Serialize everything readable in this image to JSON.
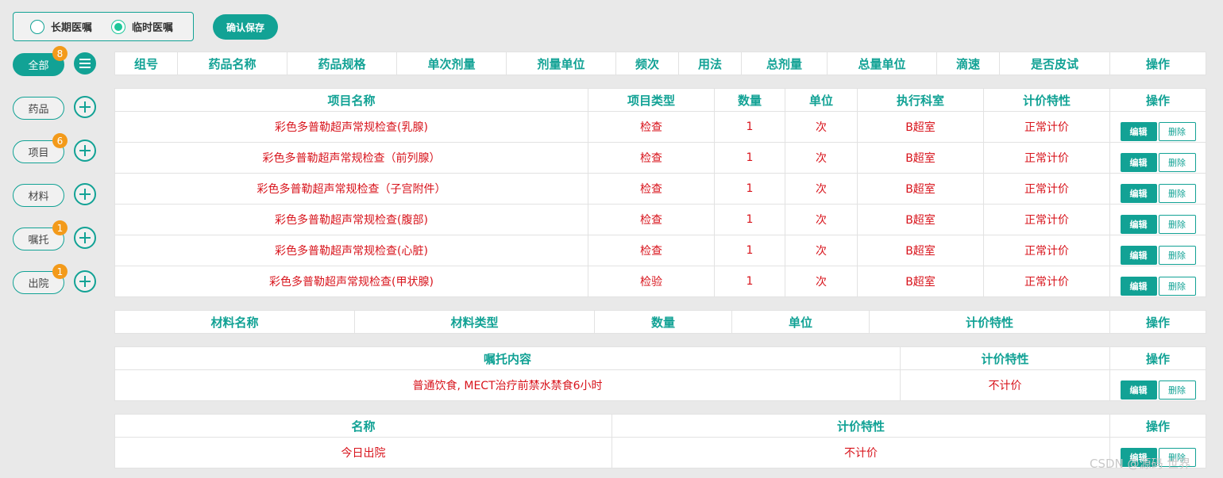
{
  "order_type": {
    "options": [
      "长期医嘱",
      "临时医嘱"
    ],
    "selected": "临时医嘱"
  },
  "confirm_save_label": "确认保存",
  "categories": [
    {
      "label": "全部",
      "badge": "8",
      "active": true,
      "icon": "list-menu-icon"
    },
    {
      "label": "药品",
      "badge": "",
      "icon": "plus-circle-icon"
    },
    {
      "label": "项目",
      "badge": "6",
      "icon": "plus-circle-icon"
    },
    {
      "label": "材料",
      "badge": "",
      "icon": "plus-circle-icon"
    },
    {
      "label": "嘱托",
      "badge": "1",
      "icon": "plus-circle-icon"
    },
    {
      "label": "出院",
      "badge": "1",
      "icon": "plus-circle-icon"
    }
  ],
  "drug_table": {
    "headers": [
      "组号",
      "药品名称",
      "药品规格",
      "单次剂量",
      "剂量单位",
      "频次",
      "用法",
      "总剂量",
      "总量单位",
      "滴速",
      "是否皮试",
      "操作"
    ]
  },
  "item_table": {
    "headers": [
      "项目名称",
      "项目类型",
      "数量",
      "单位",
      "执行科室",
      "计价特性",
      "操作"
    ],
    "rows": [
      [
        "彩色多普勒超声常规检查(乳腺)",
        "检查",
        "1",
        "次",
        "B超室",
        "正常计价"
      ],
      [
        "彩色多普勒超声常规检查（前列腺）",
        "检查",
        "1",
        "次",
        "B超室",
        "正常计价"
      ],
      [
        "彩色多普勒超声常规检查（子宫附件）",
        "检查",
        "1",
        "次",
        "B超室",
        "正常计价"
      ],
      [
        "彩色多普勒超声常规检查(腹部)",
        "检查",
        "1",
        "次",
        "B超室",
        "正常计价"
      ],
      [
        "彩色多普勒超声常规检查(心脏)",
        "检查",
        "1",
        "次",
        "B超室",
        "正常计价"
      ],
      [
        "彩色多普勒超声常规检查(甲状腺)",
        "检验",
        "1",
        "次",
        "B超室",
        "正常计价"
      ]
    ]
  },
  "material_table": {
    "headers": [
      "材料名称",
      "材料类型",
      "数量",
      "单位",
      "计价特性",
      "操作"
    ]
  },
  "entrust_table": {
    "headers": [
      "嘱托内容",
      "计价特性",
      "操作"
    ],
    "rows": [
      [
        "普通饮食, MECT治疗前禁水禁食6小时",
        "不计价"
      ]
    ]
  },
  "discharge_table": {
    "headers": [
      "名称",
      "计价特性",
      "操作"
    ],
    "rows": [
      [
        "今日出院",
        "不计价"
      ]
    ]
  },
  "row_actions": {
    "edit": "编辑",
    "delete": "删除"
  },
  "watermark": "CSDN @源码 世界",
  "colors": {
    "accent": "#12a295",
    "value_red": "#d8141c",
    "badge_orange": "#f39a1a",
    "radio_on": "#1fc79a"
  }
}
